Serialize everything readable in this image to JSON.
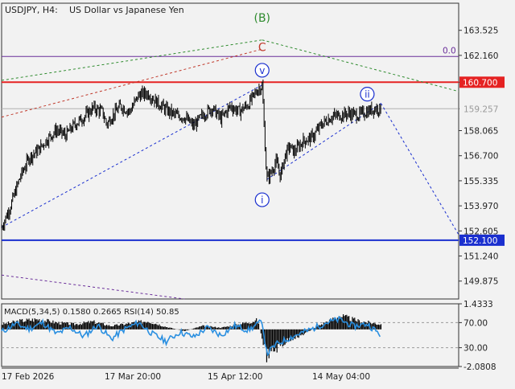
{
  "header": {
    "symbol": "USDJPY, H4:",
    "description": "US Dollar vs Japanese Yen"
  },
  "chart_data": [
    {
      "type": "line",
      "name": "price-chart",
      "series_kind": "candlestick",
      "ylim": [
        148.9,
        165.0
      ],
      "x_range": [
        0,
        100
      ],
      "y_ticks": [
        "163.525",
        "162.160",
        "160.700",
        "159.257",
        "158.065",
        "156.700",
        "155.335",
        "153.970",
        "152.605",
        "151.240",
        "149.875"
      ],
      "horizontal_levels": [
        {
          "label": "160.700",
          "value": 160.7,
          "color": "#e52222"
        },
        {
          "label": "152.100",
          "value": 152.1,
          "color": "#1a2fcf"
        },
        {
          "label": "159.257",
          "value": 159.257,
          "color": "#b0b0b0"
        },
        {
          "label": "0.0",
          "value": 162.1,
          "color": "#6a2e9a"
        }
      ],
      "price_path": [
        [
          0,
          152.8
        ],
        [
          2,
          154.0
        ],
        [
          4,
          155.5
        ],
        [
          6,
          156.6
        ],
        [
          8,
          157.0
        ],
        [
          10,
          157.6
        ],
        [
          12,
          158.1
        ],
        [
          14,
          157.8
        ],
        [
          16,
          158.4
        ],
        [
          18,
          158.8
        ],
        [
          20,
          159.3
        ],
        [
          22,
          159.1
        ],
        [
          23,
          158.4
        ],
        [
          24,
          158.8
        ],
        [
          26,
          159.4
        ],
        [
          28,
          159.1
        ],
        [
          30,
          160.0
        ],
        [
          32,
          160.1
        ],
        [
          34,
          159.6
        ],
        [
          36,
          159.2
        ],
        [
          38,
          158.9
        ],
        [
          40,
          158.8
        ],
        [
          42,
          158.3
        ],
        [
          44,
          158.9
        ],
        [
          46,
          159.3
        ],
        [
          48,
          158.7
        ],
        [
          50,
          159.4
        ],
        [
          52,
          159.1
        ],
        [
          54,
          159.5
        ],
        [
          56,
          160.3
        ],
        [
          57,
          160.5
        ],
        [
          58,
          155.4
        ],
        [
          59,
          155.8
        ],
        [
          60,
          156.4
        ],
        [
          61,
          155.6
        ],
        [
          62,
          156.7
        ],
        [
          63,
          157.2
        ],
        [
          64,
          156.9
        ],
        [
          66,
          157.5
        ],
        [
          68,
          157.7
        ],
        [
          70,
          158.4
        ],
        [
          72,
          158.8
        ],
        [
          74,
          158.9
        ],
        [
          76,
          159.0
        ],
        [
          78,
          158.9
        ],
        [
          80,
          159.1
        ],
        [
          82,
          159.3
        ],
        [
          83,
          159.2
        ]
      ],
      "trendlines": [
        {
          "from": [
            0,
            152.8
          ],
          "to": [
            57,
            160.55
          ],
          "color": "#1a2fcf",
          "style": "dashed"
        },
        {
          "from": [
            58,
            155.4
          ],
          "to": [
            83,
            159.55
          ],
          "color": "#1a2fcf",
          "style": "dashed"
        },
        {
          "from": [
            83,
            159.55
          ],
          "to": [
            100,
            152.4
          ],
          "color": "#1a2fcf",
          "style": "dashed"
        },
        {
          "from": [
            0,
            158.8
          ],
          "to": [
            57,
            162.5
          ],
          "color": "#c0392b",
          "style": "dashed"
        },
        {
          "from": [
            0,
            160.8
          ],
          "to": [
            57,
            163.0
          ],
          "color": "#2e8b2e",
          "style": "dashed"
        },
        {
          "from": [
            57,
            163.0
          ],
          "to": [
            100,
            160.2
          ],
          "color": "#2e8b2e",
          "style": "dashed"
        },
        {
          "from": [
            0,
            150.2
          ],
          "to": [
            40,
            148.9
          ],
          "color": "#6a2e9a",
          "style": "dashed"
        }
      ],
      "wave_labels": [
        {
          "text": "(B)",
          "x": 57,
          "y": 164.2,
          "color": "#2e8b2e",
          "circled": false
        },
        {
          "text": "C",
          "x": 57,
          "y": 162.6,
          "color": "#c0392b",
          "circled": false
        },
        {
          "text": "v",
          "x": 57,
          "y": 161.35,
          "color": "#1a2fcf",
          "circled": true
        },
        {
          "text": "ii",
          "x": 80,
          "y": 160.05,
          "color": "#1a2fcf",
          "circled": true
        },
        {
          "text": "i",
          "x": 57,
          "y": 154.3,
          "color": "#1a2fcf",
          "circled": true
        }
      ]
    },
    {
      "type": "line",
      "name": "indicator-panel",
      "indicator_label": "MACD(5,34,5) 0.1580 0.2665 RSI(14) 50.85",
      "ylim": [
        -2.0808,
        1.4333
      ],
      "y_ticks": [
        "1.4333",
        "70.00",
        "30.00",
        "-2.0808"
      ],
      "x_labels": [
        "17 Feb 2026",
        "17 Mar 20:00",
        "15 Apr 12:00",
        "14 May 04:00"
      ],
      "rsi_levels": [
        70,
        30
      ],
      "macd_histogram": [
        [
          0,
          0.3
        ],
        [
          4,
          0.5
        ],
        [
          8,
          0.6
        ],
        [
          12,
          0.4
        ],
        [
          16,
          0.3
        ],
        [
          20,
          0.45
        ],
        [
          24,
          0.2
        ],
        [
          28,
          0.35
        ],
        [
          32,
          0.5
        ],
        [
          36,
          0.15
        ],
        [
          40,
          -0.1
        ],
        [
          44,
          0.2
        ],
        [
          48,
          0.1
        ],
        [
          52,
          0.3
        ],
        [
          56,
          0.55
        ],
        [
          58,
          -1.6
        ],
        [
          60,
          -1.2
        ],
        [
          63,
          -0.6
        ],
        [
          66,
          -0.3
        ],
        [
          70,
          0.3
        ],
        [
          74,
          0.8
        ],
        [
          78,
          0.5
        ],
        [
          83,
          0.3
        ]
      ],
      "rsi": [
        [
          0,
          55
        ],
        [
          3,
          68
        ],
        [
          6,
          60
        ],
        [
          9,
          70
        ],
        [
          12,
          52
        ],
        [
          15,
          62
        ],
        [
          18,
          48
        ],
        [
          21,
          66
        ],
        [
          24,
          44
        ],
        [
          27,
          60
        ],
        [
          30,
          70
        ],
        [
          33,
          52
        ],
        [
          36,
          40
        ],
        [
          39,
          55
        ],
        [
          42,
          47
        ],
        [
          45,
          62
        ],
        [
          48,
          50
        ],
        [
          51,
          65
        ],
        [
          54,
          58
        ],
        [
          57,
          72
        ],
        [
          58,
          20
        ],
        [
          60,
          35
        ],
        [
          62,
          42
        ],
        [
          65,
          52
        ],
        [
          68,
          60
        ],
        [
          71,
          70
        ],
        [
          74,
          75
        ],
        [
          77,
          64
        ],
        [
          80,
          68
        ],
        [
          83,
          50
        ]
      ]
    }
  ]
}
